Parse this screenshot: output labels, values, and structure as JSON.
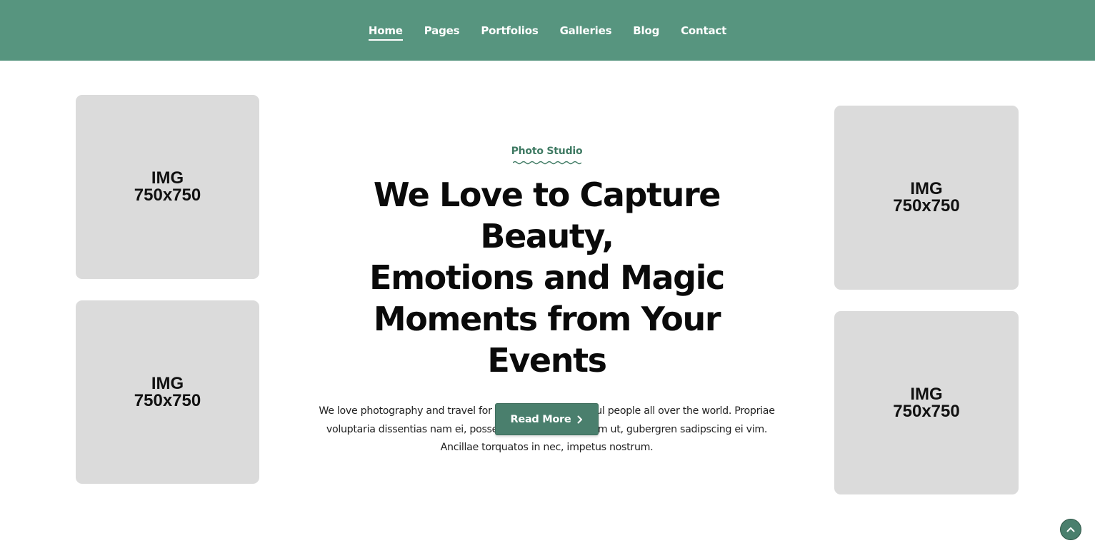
{
  "nav": {
    "items": [
      {
        "label": "Home",
        "active": true
      },
      {
        "label": "Pages",
        "active": false
      },
      {
        "label": "Portfolios",
        "active": false
      },
      {
        "label": "Galleries",
        "active": false
      },
      {
        "label": "Blog",
        "active": false
      },
      {
        "label": "Contact",
        "active": false
      }
    ]
  },
  "placeholders": [
    {
      "label": "IMG\n750x750"
    },
    {
      "label": "IMG\n750x750"
    },
    {
      "label": "IMG\n750x750"
    },
    {
      "label": "IMG\n750x750"
    }
  ],
  "hero": {
    "eyebrow": "Photo Studio",
    "headline_line1": "We Love to Capture Beauty,",
    "headline_line2": "Emotions and Magic",
    "headline_line3": "Moments from Your Events",
    "paragraph_line1": "We love photography and travel for meeting new beautiful people all over the world. Propriae",
    "paragraph_line2": "voluptaria dissentias nam ei, posse diceret inciderint cum ut, gubergren sadipscing ei vim.",
    "paragraph_line3": "Ancillae torquatos in nec, impetus nostrum.",
    "button_label": "Read More",
    "button_icon": "chevron-right-icon"
  },
  "back_to_top": {
    "icon": "chevron-up-icon"
  },
  "colors": {
    "header_bg": "#57957f",
    "accent": "#4a7f6d",
    "placeholder_bg": "#dbdbdb",
    "eyebrow": "#3f7a63"
  }
}
